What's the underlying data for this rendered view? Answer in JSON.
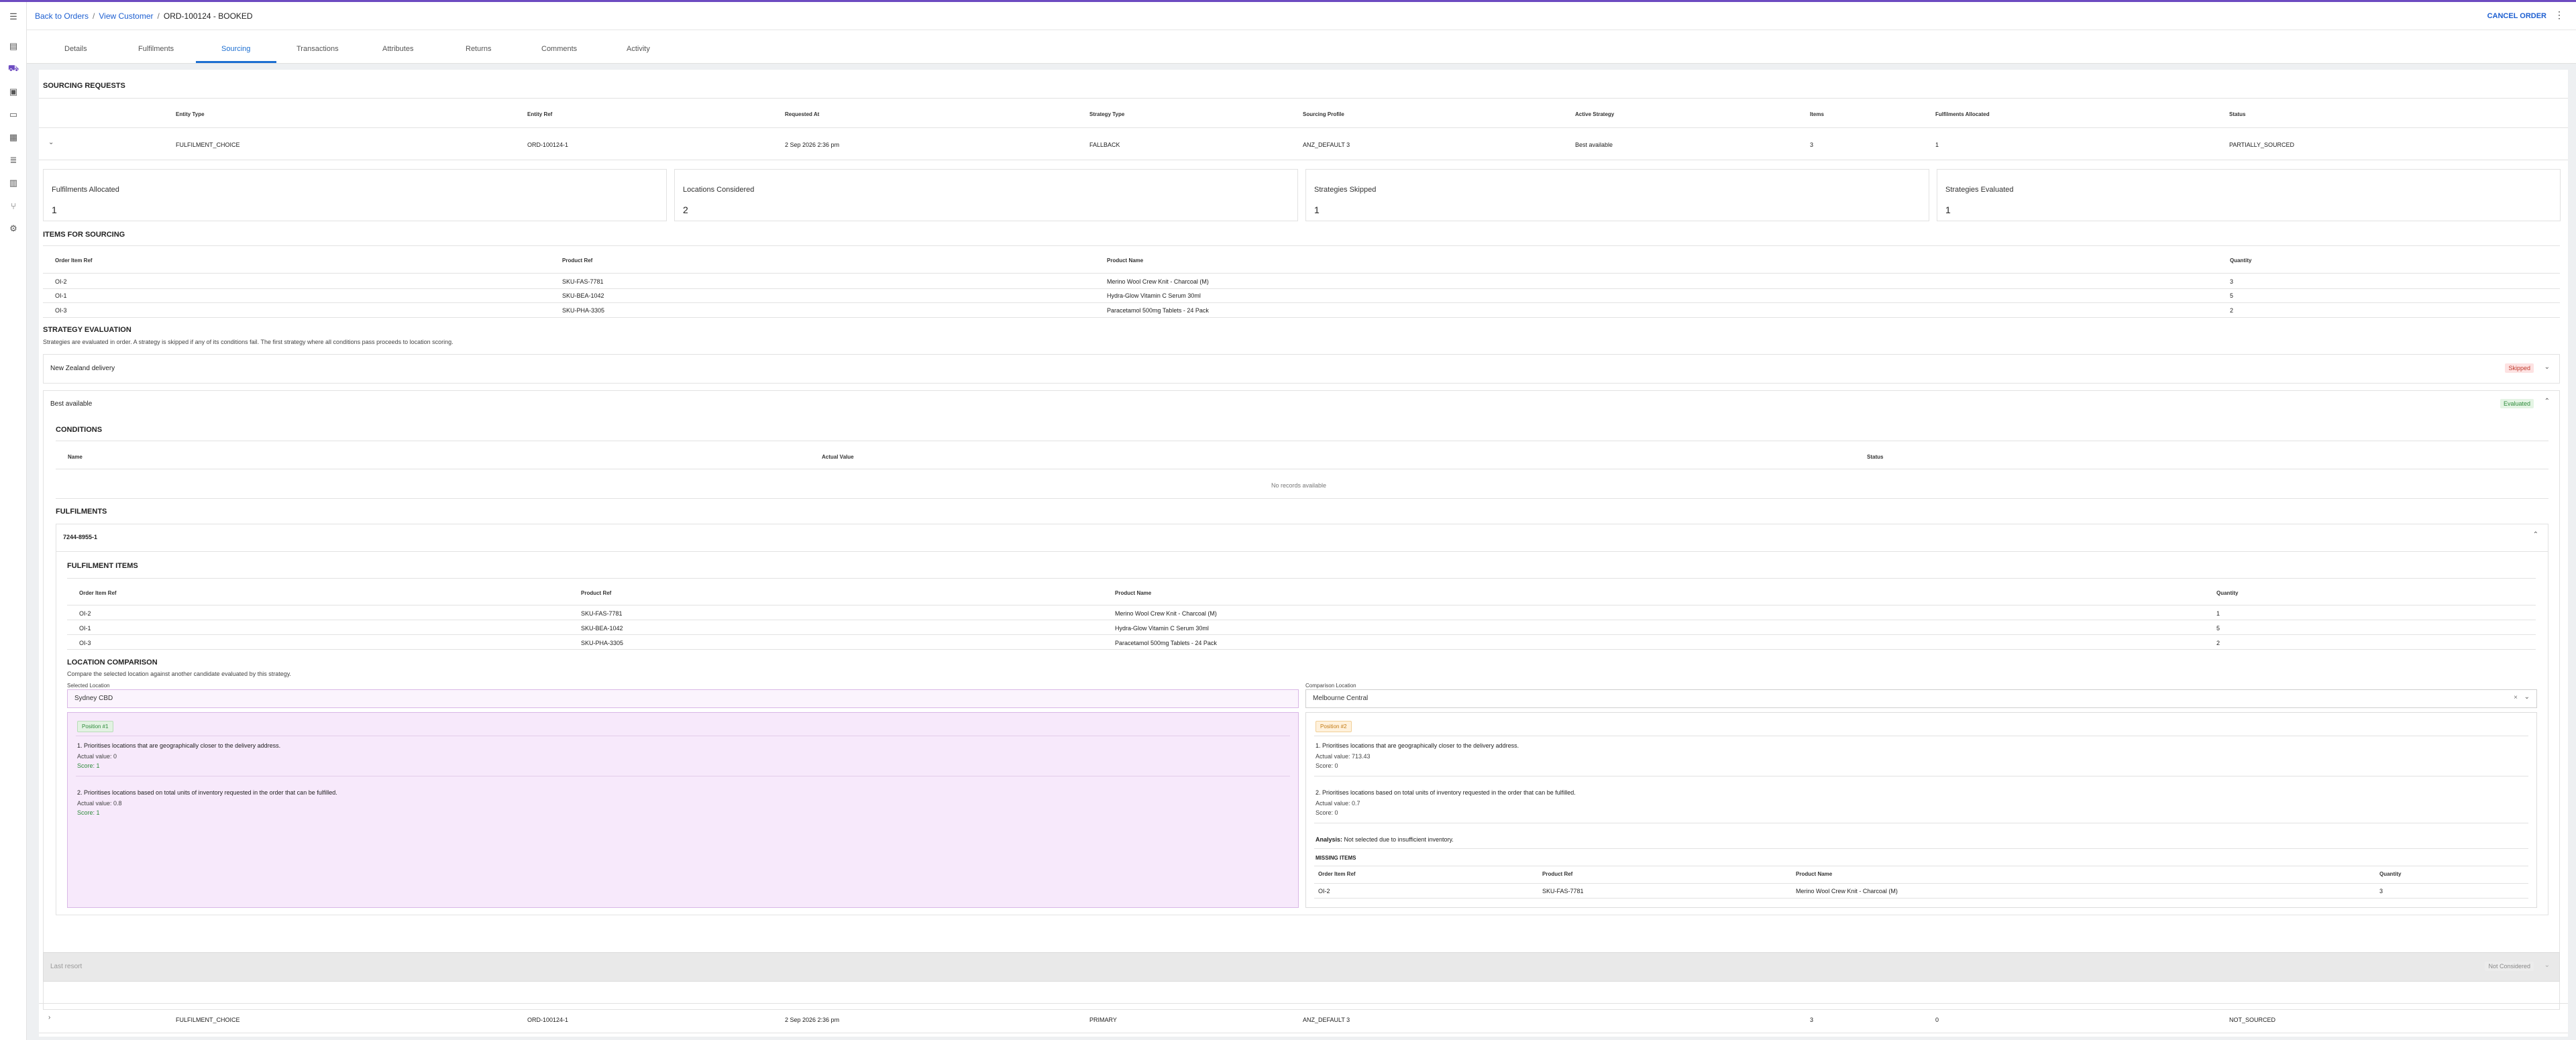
{
  "header": {
    "breadcrumb_back": "Back to Orders",
    "breadcrumb_customer": "View Customer",
    "breadcrumb_current": "ORD-100124 - BOOKED",
    "cancel_order": "CANCEL ORDER",
    "more_icon": "kebab-icon"
  },
  "sidebar": {
    "icons": [
      "menu-icon",
      "list-icon",
      "cart-icon",
      "box-icon",
      "truck-icon",
      "grid-icon",
      "list-icon",
      "layers-icon",
      "branch-icon",
      "gear-icon"
    ]
  },
  "tabs": [
    "Details",
    "Fulfilments",
    "Sourcing",
    "Transactions",
    "Attributes",
    "Returns",
    "Comments",
    "Activity"
  ],
  "active_tab": "Sourcing",
  "sourcing_requests": {
    "title": "SOURCING REQUESTS",
    "columns": [
      "Entity Type",
      "Entity Ref",
      "Requested At",
      "Strategy Type",
      "Sourcing Profile",
      "Active Strategy",
      "Items",
      "Fulfilments Allocated",
      "Status"
    ],
    "rows": [
      [
        "FULFILMENT_CHOICE",
        "ORD-100124-1",
        "2 Sep 2026 2:36 pm",
        "FALLBACK",
        "ANZ_DEFAULT 3",
        "Best available",
        "3",
        "1",
        "PARTIALLY_SOURCED"
      ],
      [
        "FULFILMENT_CHOICE",
        "ORD-100124-1",
        "2 Sep 2026 2:36 pm",
        "PRIMARY",
        "ANZ_DEFAULT 3",
        "",
        "3",
        "0",
        "NOT_SOURCED"
      ]
    ]
  },
  "metrics": [
    {
      "label": "Fulfilments Allocated",
      "value": "1"
    },
    {
      "label": "Locations Considered",
      "value": "2"
    },
    {
      "label": "Strategies Skipped",
      "value": "1"
    },
    {
      "label": "Strategies Evaluated",
      "value": "1"
    }
  ],
  "items_for_sourcing": {
    "title": "ITEMS FOR SOURCING",
    "columns": [
      "Order Item Ref",
      "Product Ref",
      "Product Name",
      "Quantity"
    ],
    "rows": [
      [
        "OI-2",
        "SKU-FAS-7781",
        "Merino Wool Crew Knit - Charcoal (M)",
        "3"
      ],
      [
        "OI-1",
        "SKU-BEA-1042",
        "Hydra-Glow Vitamin C Serum 30ml",
        "5"
      ],
      [
        "OI-3",
        "SKU-PHA-3305",
        "Paracetamol 500mg Tablets - 24 Pack",
        "2"
      ]
    ]
  },
  "strategy_evaluation": {
    "title": "STRATEGY EVALUATION",
    "description": "Strategies are evaluated in order. A strategy is skipped if any of its conditions fail. The first strategy where all conditions pass proceeds to location scoring.",
    "strategies": [
      {
        "name": "New Zealand delivery",
        "status": "Skipped"
      },
      {
        "name": "Best available",
        "status": "Evaluated"
      },
      {
        "name": "Last resort",
        "status": "Not Considered"
      }
    ]
  },
  "conditions": {
    "title": "CONDITIONS",
    "columns": [
      "Name",
      "Actual Value",
      "Status"
    ],
    "empty": "No records available"
  },
  "fulfilments": {
    "title": "FULFILMENTS",
    "ref": "7244-8955-1",
    "items_title": "FULFILMENT ITEMS",
    "columns": [
      "Order Item Ref",
      "Product Ref",
      "Product Name",
      "Quantity"
    ],
    "rows": [
      [
        "OI-2",
        "SKU-FAS-7781",
        "Merino Wool Crew Knit - Charcoal (M)",
        "1"
      ],
      [
        "OI-1",
        "SKU-BEA-1042",
        "Hydra-Glow Vitamin C Serum 30ml",
        "5"
      ],
      [
        "OI-3",
        "SKU-PHA-3305",
        "Paracetamol 500mg Tablets - 24 Pack",
        "2"
      ]
    ]
  },
  "location_comparison": {
    "title": "LOCATION COMPARISON",
    "description": "Compare the selected location against another candidate evaluated by this strategy.",
    "selected_label": "Selected Location",
    "selected_value": "Sydney CBD",
    "comparison_label": "Comparison Location",
    "comparison_value": "Melbourne Central",
    "selected": {
      "position": "Position #1",
      "rules": [
        {
          "text": "1. Prioritises locations that are geographically closer to the delivery address.",
          "actual": "Actual value: 0",
          "score": "Score: 1"
        },
        {
          "text": "2. Prioritises locations based on total units of inventory requested in the order that can be fulfilled.",
          "actual": "Actual value: 0.8",
          "score": "Score: 1"
        }
      ]
    },
    "comparison": {
      "position": "Position #2",
      "rules": [
        {
          "text": "1. Prioritises locations that are geographically closer to the delivery address.",
          "actual": "Actual value: 713.43",
          "score": "Score: 0"
        },
        {
          "text": "2. Prioritises locations based on total units of inventory requested in the order that can be fulfilled.",
          "actual": "Actual value: 0.7",
          "score": "Score: 0"
        }
      ],
      "analysis_label": "Analysis:",
      "analysis_text": "Not selected due to insufficient inventory.",
      "missing_title": "MISSING ITEMS",
      "missing_columns": [
        "Order Item Ref",
        "Product Ref",
        "Product Name",
        "Quantity"
      ],
      "missing_rows": [
        [
          "OI-2",
          "SKU-FAS-7781",
          "Merino Wool Crew Knit - Charcoal (M)",
          "3"
        ]
      ]
    }
  },
  "colors": {
    "accent": "#6d4bc1",
    "link": "#1d5fd1",
    "selected_bg": "#f7e9fb"
  }
}
